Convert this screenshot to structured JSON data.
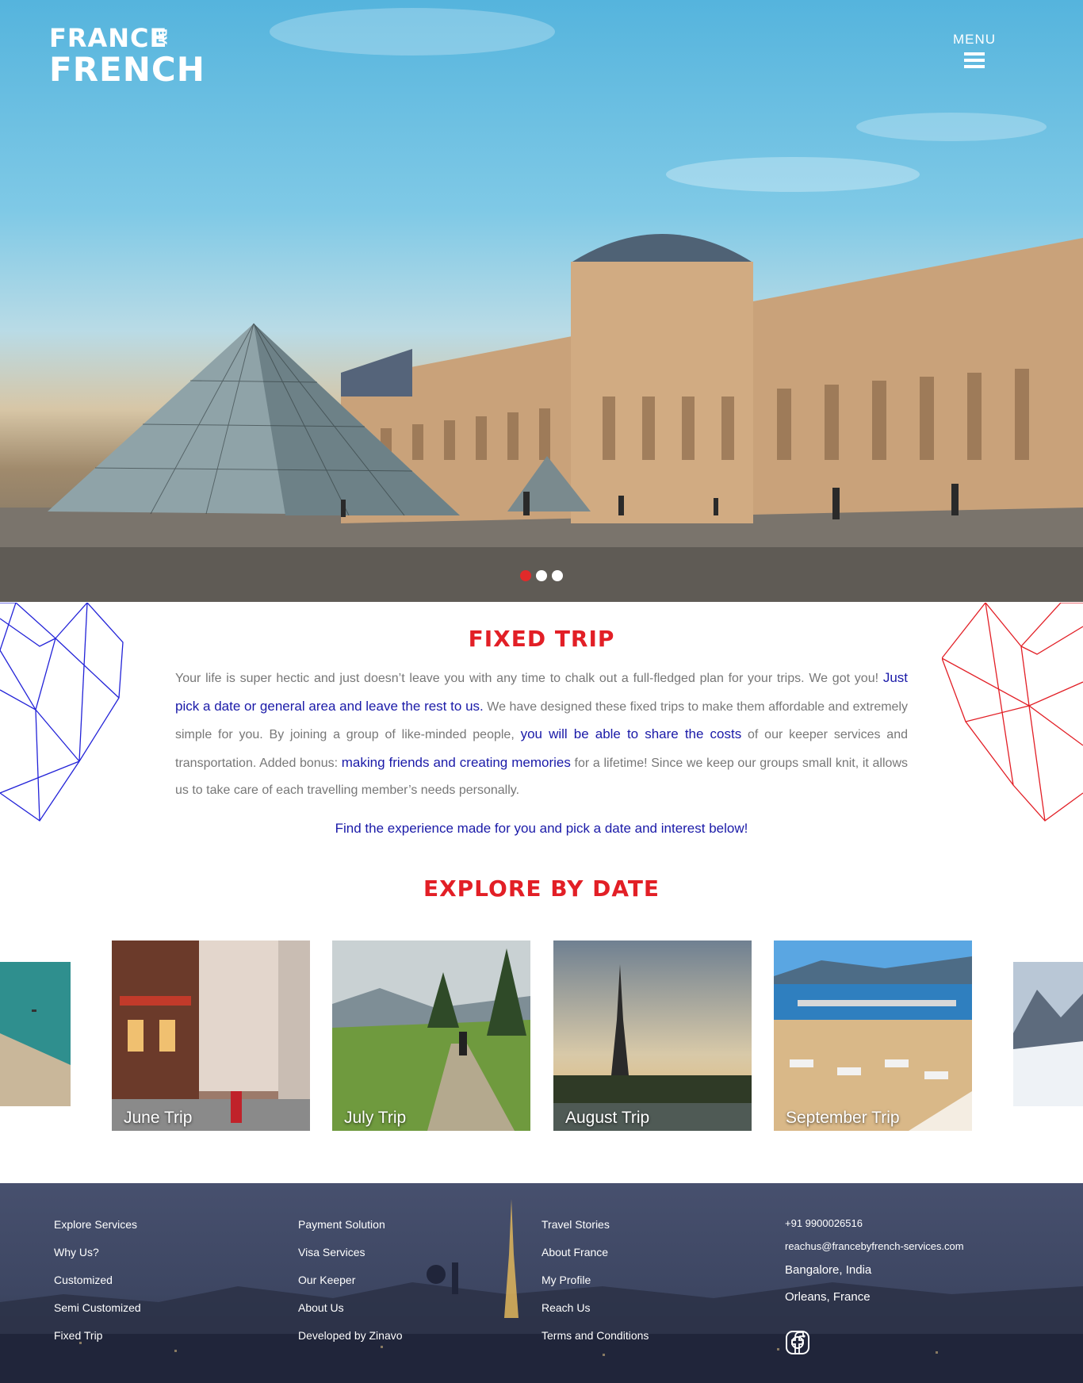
{
  "header": {
    "logo_line1": "FRANCE",
    "logo_by": "BY",
    "logo_line2": "FRENCH",
    "menu_label": "MENU",
    "menu_icon": "hamburger-icon"
  },
  "hero": {
    "slides": 3,
    "active_slide": 1
  },
  "fixed_trip": {
    "title": "FIXED TRIP",
    "p1": "Your life is super hectic and just doesn’t leave you with any time to chalk out a full-fledged plan for your trips. We got you! ",
    "hl1": "Just pick a date or general area and leave the rest to us.",
    "p2": " We have designed these fixed trips to make them affordable and extremely simple for you. By joining a group of like-minded people, ",
    "hl2": "you will be able to share the costs",
    "p3": " of our keeper services and transportation. Added bonus: ",
    "hl3": "making friends and creating memories",
    "p4": " for a lifetime! Since we keep our groups small knit, it allows us to take care of each travelling member’s needs personally.",
    "cta": "Find the experience made for you and pick a date and interest below!"
  },
  "explore": {
    "title": "EXPLORE BY DATE",
    "cards": [
      {
        "label": "June Trip"
      },
      {
        "label": "July Trip"
      },
      {
        "label": "August Trip"
      },
      {
        "label": "September Trip"
      }
    ]
  },
  "footer": {
    "col1": [
      "Explore Services",
      "Why Us?",
      "Customized",
      "Semi Customized",
      "Fixed Trip"
    ],
    "col2": [
      "Payment Solution",
      "Visa Services",
      "Our Keeper",
      "About Us",
      "Developed by Zinavo"
    ],
    "col3": [
      "Travel Stories",
      "About France",
      "My Profile",
      "Reach Us",
      "Terms and Conditions"
    ],
    "phone": "+91 9900026516",
    "email": "reachus@francebyfrench-services.com",
    "city1": "Bangalore, India",
    "city2": "Orleans, France",
    "social": [
      "instagram-icon",
      "facebook-icon"
    ]
  },
  "colors": {
    "accent_red": "#e21f26",
    "accent_blue": "#1a1aa8"
  }
}
